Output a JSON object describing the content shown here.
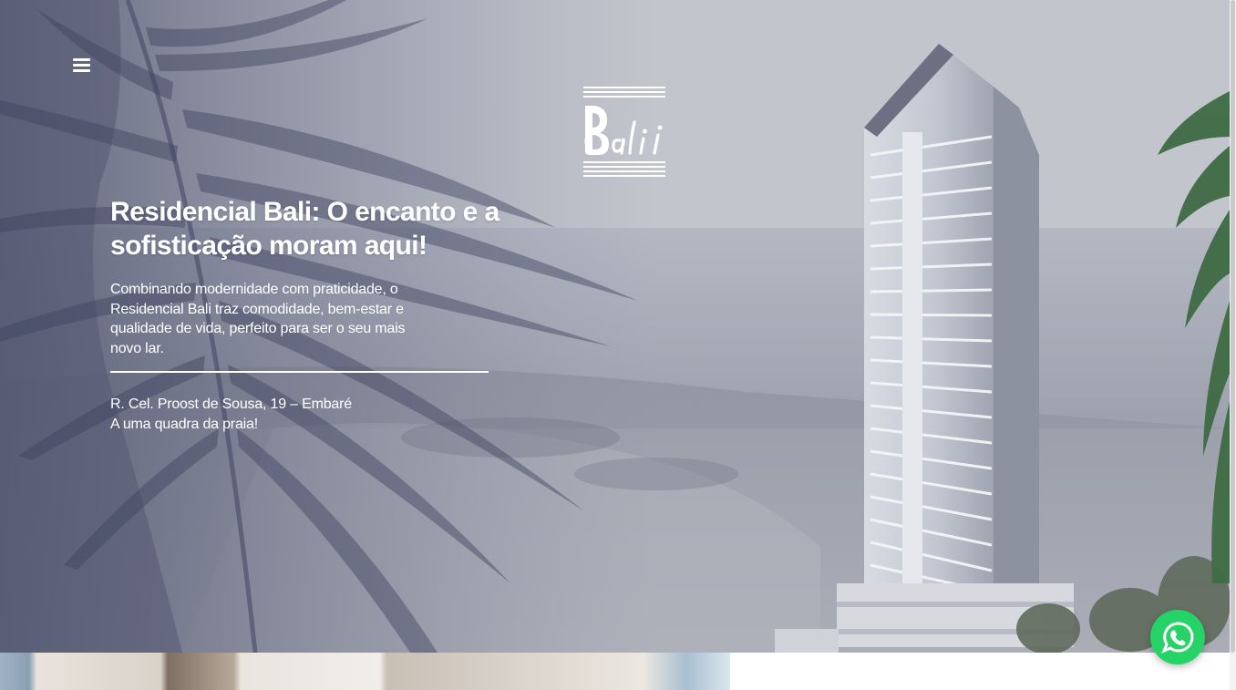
{
  "hero": {
    "headline": "Residencial Bali: O encanto e a sofisticação moram aqui!",
    "description": "Combinando modernidade com praticidade, o Residencial Bali traz comodidade, bem-estar e qualidade de vida, perfeito para ser o seu mais novo lar.",
    "address_line1": "R. Cel. Proost de Sousa, 19 – Embaré",
    "address_line2": "A uma quadra da praia!"
  },
  "logo": {
    "text": "Bali"
  },
  "icons": {
    "menu": "hamburger-menu-icon",
    "whatsapp": "whatsapp-icon"
  },
  "colors": {
    "hero_overlay": "#9a9ea9",
    "text": "#ffffff",
    "whatsapp": "#25d366"
  }
}
